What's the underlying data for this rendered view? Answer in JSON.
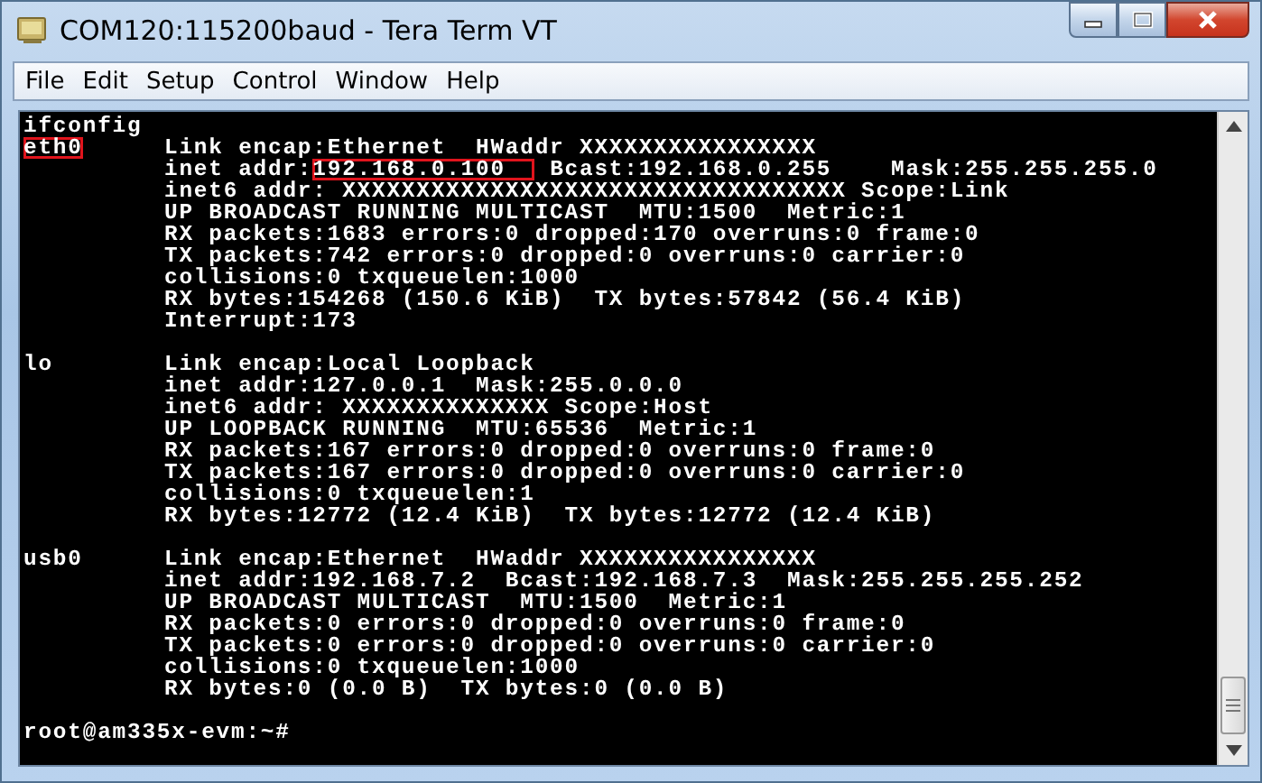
{
  "window": {
    "title": "COM120:115200baud - Tera Term VT"
  },
  "menu": [
    {
      "label": "File"
    },
    {
      "label": "Edit"
    },
    {
      "label": "Setup"
    },
    {
      "label": "Control"
    },
    {
      "label": "Window"
    },
    {
      "label": "Help"
    }
  ],
  "terminal": {
    "lines": [
      {
        "kind": "command",
        "text": "ifconfig"
      },
      {
        "kind": "interface",
        "label": "eth0",
        "label_highlighted": true,
        "segments": [
          {
            "text": "Link encap:Ethernet  HWaddr XXXXXXXXXXXXXXXX",
            "highlighted": false
          }
        ]
      },
      {
        "kind": "detail",
        "segments": [
          {
            "text": "inet addr:",
            "highlighted": false
          },
          {
            "text": "192.168.0.100  ",
            "highlighted": true
          },
          {
            "text": " Bcast:192.168.0.255    Mask:255.255.255.0",
            "highlighted": false
          }
        ]
      },
      {
        "kind": "detail",
        "segments": [
          {
            "text": "inet6 addr: XXXXXXXXXXXXXXXXXXXXXXXXXXXXXXXXXX Scope:Link",
            "highlighted": false
          }
        ]
      },
      {
        "kind": "detail",
        "segments": [
          {
            "text": "UP BROADCAST RUNNING MULTICAST  MTU:1500  Metric:1",
            "highlighted": false
          }
        ]
      },
      {
        "kind": "detail",
        "segments": [
          {
            "text": "RX packets:1683 errors:0 dropped:170 overruns:0 frame:0",
            "highlighted": false
          }
        ]
      },
      {
        "kind": "detail",
        "segments": [
          {
            "text": "TX packets:742 errors:0 dropped:0 overruns:0 carrier:0",
            "highlighted": false
          }
        ]
      },
      {
        "kind": "detail",
        "segments": [
          {
            "text": "collisions:0 txqueuelen:1000",
            "highlighted": false
          }
        ]
      },
      {
        "kind": "detail",
        "segments": [
          {
            "text": "RX bytes:154268 (150.6 KiB)  TX bytes:57842 (56.4 KiB)",
            "highlighted": false
          }
        ]
      },
      {
        "kind": "detail",
        "segments": [
          {
            "text": "Interrupt:173",
            "highlighted": false
          }
        ]
      },
      {
        "kind": "blank"
      },
      {
        "kind": "interface",
        "label": "lo",
        "label_highlighted": false,
        "segments": [
          {
            "text": "Link encap:Local Loopback",
            "highlighted": false
          }
        ]
      },
      {
        "kind": "detail",
        "segments": [
          {
            "text": "inet addr:127.0.0.1  Mask:255.0.0.0",
            "highlighted": false
          }
        ]
      },
      {
        "kind": "detail",
        "segments": [
          {
            "text": "inet6 addr: XXXXXXXXXXXXXX Scope:Host",
            "highlighted": false
          }
        ]
      },
      {
        "kind": "detail",
        "segments": [
          {
            "text": "UP LOOPBACK RUNNING  MTU:65536  Metric:1",
            "highlighted": false
          }
        ]
      },
      {
        "kind": "detail",
        "segments": [
          {
            "text": "RX packets:167 errors:0 dropped:0 overruns:0 frame:0",
            "highlighted": false
          }
        ]
      },
      {
        "kind": "detail",
        "segments": [
          {
            "text": "TX packets:167 errors:0 dropped:0 overruns:0 carrier:0",
            "highlighted": false
          }
        ]
      },
      {
        "kind": "detail",
        "segments": [
          {
            "text": "collisions:0 txqueuelen:1",
            "highlighted": false
          }
        ]
      },
      {
        "kind": "detail",
        "segments": [
          {
            "text": "RX bytes:12772 (12.4 KiB)  TX bytes:12772 (12.4 KiB)",
            "highlighted": false
          }
        ]
      },
      {
        "kind": "blank"
      },
      {
        "kind": "interface",
        "label": "usb0",
        "label_highlighted": false,
        "segments": [
          {
            "text": "Link encap:Ethernet  HWaddr XXXXXXXXXXXXXXXX",
            "highlighted": false
          }
        ]
      },
      {
        "kind": "detail",
        "segments": [
          {
            "text": "inet addr:192.168.7.2  Bcast:192.168.7.3  Mask:255.255.255.252",
            "highlighted": false
          }
        ]
      },
      {
        "kind": "detail",
        "segments": [
          {
            "text": "UP BROADCAST MULTICAST  MTU:1500  Metric:1",
            "highlighted": false
          }
        ]
      },
      {
        "kind": "detail",
        "segments": [
          {
            "text": "RX packets:0 errors:0 dropped:0 overruns:0 frame:0",
            "highlighted": false
          }
        ]
      },
      {
        "kind": "detail",
        "segments": [
          {
            "text": "TX packets:0 errors:0 dropped:0 overruns:0 carrier:0",
            "highlighted": false
          }
        ]
      },
      {
        "kind": "detail",
        "segments": [
          {
            "text": "collisions:0 txqueuelen:1000",
            "highlighted": false
          }
        ]
      },
      {
        "kind": "detail",
        "segments": [
          {
            "text": "RX bytes:0 (0.0 B)  TX bytes:0 (0.0 B)",
            "highlighted": false
          }
        ]
      },
      {
        "kind": "blank"
      },
      {
        "kind": "prompt",
        "text": "root@am335x-evm:~#"
      }
    ]
  }
}
